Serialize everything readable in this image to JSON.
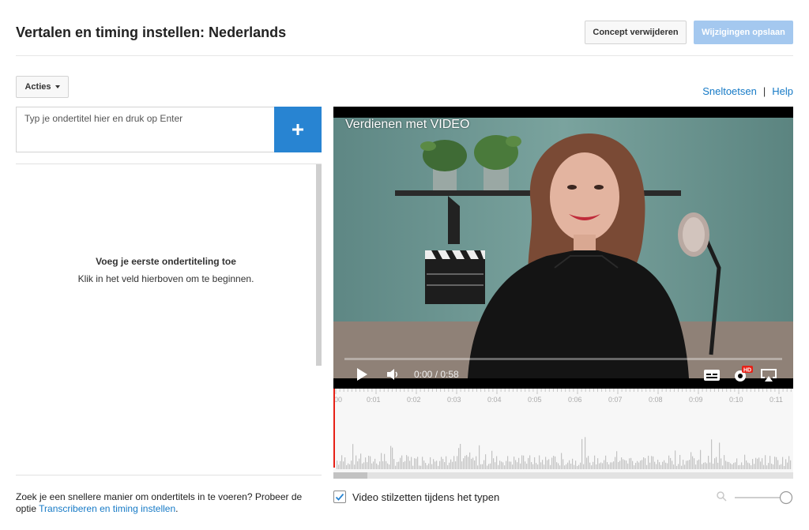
{
  "header": {
    "title": "Vertalen en timing instellen: Nederlands",
    "delete_draft_label": "Concept verwijderen",
    "save_label": "Wijzigingen opslaan"
  },
  "toolbar": {
    "actions_label": "Acties",
    "shortcuts_label": "Sneltoetsen",
    "separator": "|",
    "help_label": "Help"
  },
  "editor": {
    "subtitle_placeholder": "Typ je ondertitel hier en druk op Enter",
    "add_icon": "plus-icon",
    "empty_title": "Voeg je eerste ondertiteling toe",
    "empty_subtitle": "Klik in het veld hierboven om te beginnen."
  },
  "hint": {
    "text": "Zoek je een snellere manier om ondertitels in te voeren? Probeer de optie",
    "link": "Transcriberen en timing instellen",
    "end": "."
  },
  "video": {
    "title": "Verdienen met VIDEO",
    "time": "0:00 / 0:58",
    "progress": 0,
    "clapper_text": "PRODUCTION",
    "quality_badge": "HD"
  },
  "timeline": {
    "labels": [
      "00",
      "0:01",
      "0:02",
      "0:03",
      "0:04",
      "0:05",
      "0:06",
      "0:07",
      "0:08",
      "0:09",
      "0:10",
      "0:11"
    ]
  },
  "options": {
    "pause_label": "Video stilzetten tijdens het typen",
    "pause_checked": true
  },
  "colors": {
    "accent": "#2884d2",
    "save_disabled": "#a4c8ef",
    "link": "#167ac6",
    "playhead": "#e62117"
  }
}
